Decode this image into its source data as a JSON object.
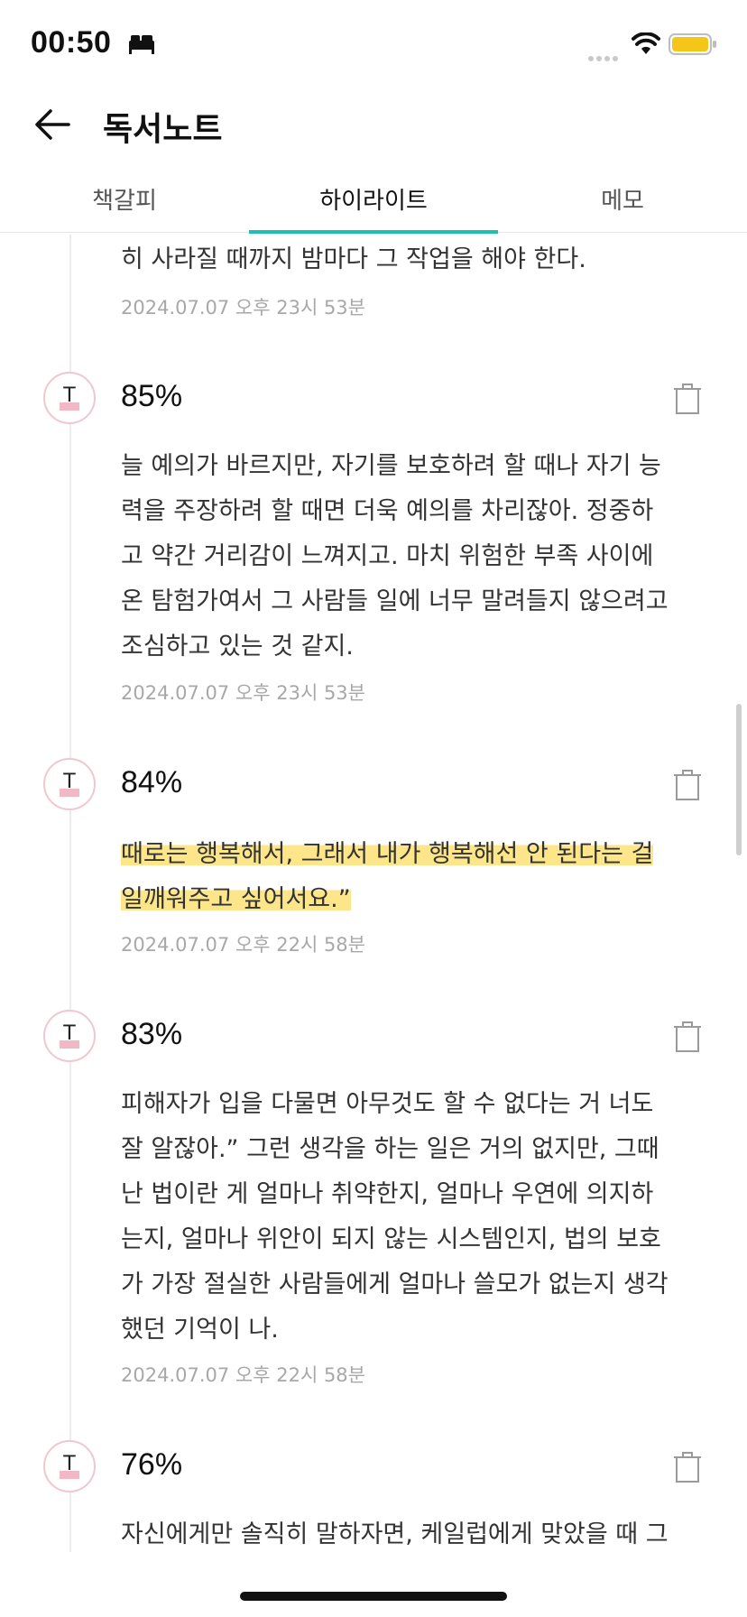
{
  "status_bar": {
    "time": "00:50"
  },
  "header": {
    "title": "독서노트"
  },
  "tabs": [
    {
      "label": "책갈피",
      "active": false
    },
    {
      "label": "하이라이트",
      "active": true
    },
    {
      "label": "메모",
      "active": false
    }
  ],
  "top_entry": {
    "text": "히 사라질 때까지 밤마다 그 작업을 해야 한다.",
    "timestamp": "2024.07.07 오후 23시 53분"
  },
  "entries": [
    {
      "badge": "T",
      "percent": "85%",
      "lines": [
        "늘 예의가 바르지만, 자기를 보호하려 할 때나 자기 능",
        "력을 주장하려 할 때면 더욱 예의를 차리잖아. 정중하",
        "고 약간 거리감이 느껴지고. 마치 위험한 부족 사이에",
        "온 탐험가여서 그 사람들 일에 너무 말려들지 않으려고",
        "조심하고 있는 것 같지."
      ],
      "timestamp": "2024.07.07 오후 23시 53분"
    },
    {
      "badge": "T",
      "percent": "84%",
      "lines": [
        "때로는 행복해서, 그래서 내가 행복해선 안 된다는 걸",
        "일깨워주고 싶어서요.”"
      ],
      "timestamp": "2024.07.07 오후 22시 58분",
      "highlight_color": "#fde68a"
    },
    {
      "badge": "T",
      "percent": "83%",
      "lines": [
        "피해자가 입을 다물면 아무것도 할 수 없다는 거 너도",
        "잘 알잖아.” 그런 생각을 하는 일은 거의 없지만, 그때",
        "난 법이란 게 얼마나 취약한지, 얼마나 우연에 의지하",
        "는지, 얼마나 위안이 되지 않는 시스템인지, 법의 보호",
        "가 가장 절실한 사람들에게 얼마나 쓸모가 없는지 생각",
        "했던 기억이 나."
      ],
      "timestamp": "2024.07.07 오후 22시 58분"
    },
    {
      "badge": "T",
      "percent": "76%",
      "lines": [
        "자신에게만 솔직히 말하자면, 케일럽에게 맞았을 때 그"
      ]
    }
  ],
  "colors": {
    "accent": "#1fbfb3",
    "badge_border": "#f0c7d0",
    "badge_mark": "#f3b8c6",
    "battery": "#f5c518"
  },
  "icons": [
    "sleep-icon",
    "signal-icon",
    "wifi-icon",
    "battery-icon",
    "back-arrow-icon",
    "trash-icon"
  ]
}
